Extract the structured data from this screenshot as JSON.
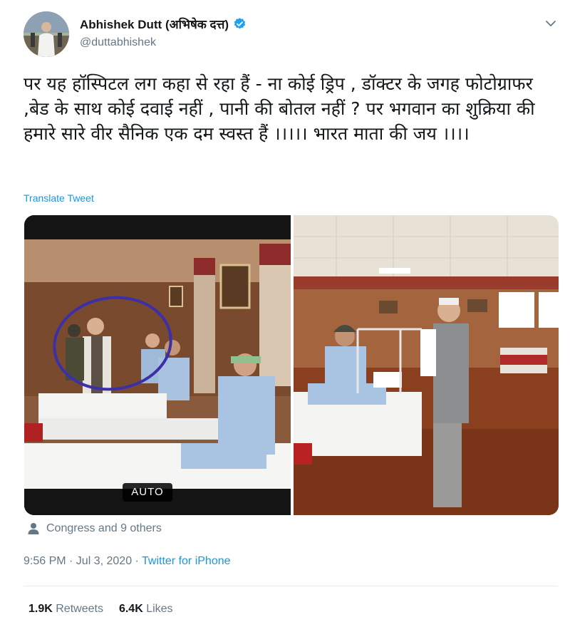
{
  "user": {
    "name": "Abhishek Dutt (अभिषेक दत्त)",
    "handle": "@duttabhishek",
    "verified": true
  },
  "tweet": {
    "text": "पर यह हॉस्पिटल लग कहा से रहा हैं - ना कोई ड्रिप , डॉक्टर के जगह फोटोग्राफर ,बेड के साथ कोई दवाई नहीं , पानी की बोतल नहीं ? पर भगवान का शुक्रिया की हमारे सारे वीर सैनिक एक दम स्वस्त हैं ।।।।। भारत माता की जय ।।।।",
    "translate_label": "Translate Tweet",
    "media_badge": "AUTO"
  },
  "liked_by": "Congress and 9 others",
  "meta": {
    "time": "9:56 PM · Jul 3, 2020 · ",
    "source": "Twitter for iPhone"
  },
  "stats": {
    "retweets_count": "1.9K",
    "retweets_label": "Retweets",
    "likes_count": "6.4K",
    "likes_label": "Likes"
  },
  "colors": {
    "link": "#1b95e0",
    "secondary_text": "#657786",
    "verified": "#1da1f2",
    "annotation_circle": "#3d2fa8"
  },
  "icons": {
    "verified": "verified-badge-icon",
    "caret": "chevron-down-icon",
    "person": "person-icon"
  }
}
